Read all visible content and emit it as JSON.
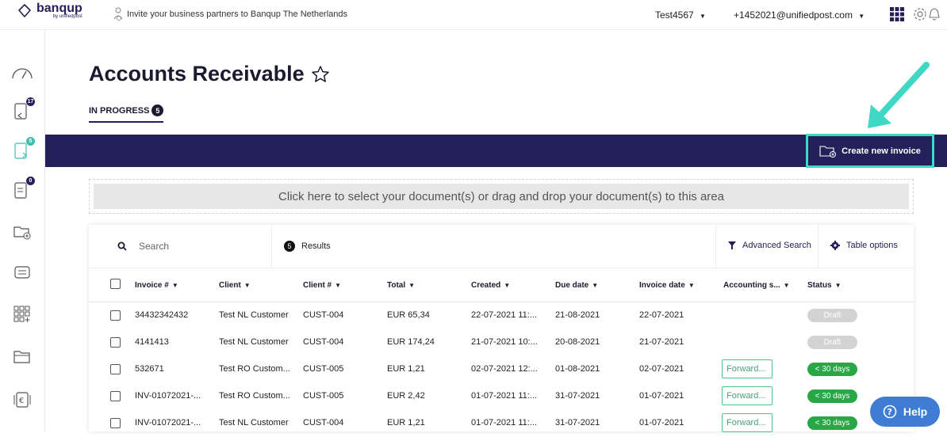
{
  "topbar": {
    "logo_text": "banqup",
    "logo_sub": "by unifiedpost",
    "invite_text": "Invite your business partners to Banqup The Netherlands",
    "org_name": "Test4567",
    "user_email": "+1452021@unifiedpost.com"
  },
  "sidebar": {
    "badges": {
      "inbound": "17",
      "outbound": "5",
      "other": "0"
    }
  },
  "page": {
    "title": "Accounts Receivable",
    "tab_label": "IN PROGRESS",
    "tab_count": "5",
    "create_button": "Create new invoice",
    "dropzone_text": "Click here to select your document(s) or drag and drop your document(s) to this area"
  },
  "toolbar": {
    "search_placeholder": "Search",
    "results_count": "5",
    "results_label": "Results",
    "advanced_search": "Advanced Search",
    "table_options": "Table options"
  },
  "table": {
    "columns": [
      "Invoice #",
      "Client",
      "Client #",
      "Total",
      "Created",
      "Due date",
      "Invoice date",
      "Accounting s...",
      "Status"
    ],
    "rows": [
      {
        "invoice": "34432342432",
        "client": "Test NL Customer",
        "client_no": "CUST-004",
        "total": "EUR 65,34",
        "created": "22-07-2021 11:...",
        "due": "21-08-2021",
        "inv_date": "22-07-2021",
        "accounting": "",
        "status": "Draft"
      },
      {
        "invoice": "4141413",
        "client": "Test NL Customer",
        "client_no": "CUST-004",
        "total": "EUR 174,24",
        "created": "21-07-2021 10:...",
        "due": "20-08-2021",
        "inv_date": "21-07-2021",
        "accounting": "",
        "status": "Draft"
      },
      {
        "invoice": "532671",
        "client": "Test RO Custom...",
        "client_no": "CUST-005",
        "total": "EUR 1,21",
        "created": "02-07-2021 12:...",
        "due": "01-08-2021",
        "inv_date": "02-07-2021",
        "accounting": "Forward...",
        "status": "< 30 days"
      },
      {
        "invoice": "INV-01072021-...",
        "client": "Test RO Custom...",
        "client_no": "CUST-005",
        "total": "EUR 2,42",
        "created": "01-07-2021 11:...",
        "due": "31-07-2021",
        "inv_date": "01-07-2021",
        "accounting": "Forward...",
        "status": "< 30 days"
      },
      {
        "invoice": "INV-01072021-...",
        "client": "Test NL Customer",
        "client_no": "CUST-004",
        "total": "EUR 1,21",
        "created": "01-07-2021 11:...",
        "due": "31-07-2021",
        "inv_date": "01-07-2021",
        "accounting": "Forward...",
        "status": "< 30 days"
      }
    ]
  },
  "help_label": "Help",
  "colors": {
    "navy": "#23205a",
    "teal": "#3fd8c4",
    "green": "#27a745",
    "help": "#3f7dd4"
  }
}
